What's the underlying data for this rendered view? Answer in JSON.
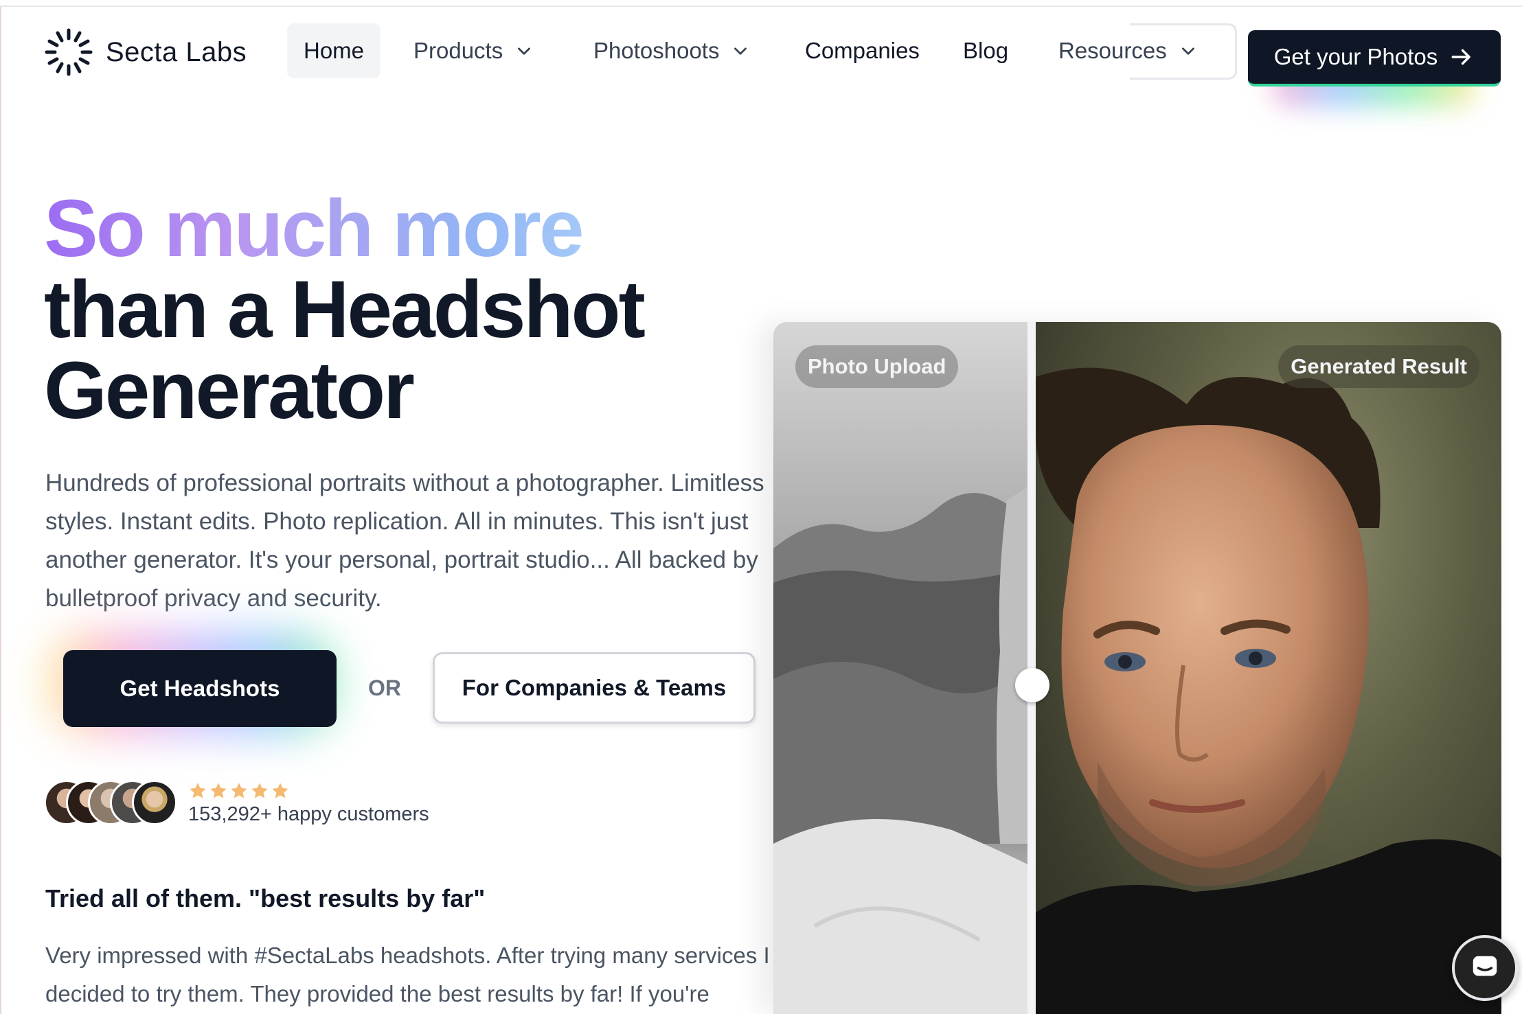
{
  "brand": {
    "name": "Secta Labs",
    "logo_icon": "sun-burst-logo"
  },
  "nav": {
    "home": "Home",
    "products": "Products",
    "photoshoots": "Photoshoots",
    "companies": "Companies",
    "blog": "Blog",
    "resources": "Resources",
    "cta": "Get your Photos"
  },
  "hero": {
    "line1": "So much more",
    "line2": "than a Headshot",
    "line3": "Generator",
    "description": "Hundreds of professional portraits without a photographer. Limitless styles. Instant edits. Photo replication. All in minutes. This isn't just another generator. It's your personal, portrait studio... All backed by bulletproof privacy and security.",
    "primary_button": "Get Headshots",
    "or_label": "OR",
    "secondary_button": "For Companies & Teams",
    "rating_stars": 5,
    "customers": "153,292+ happy customers"
  },
  "testimonial": {
    "title": "Tried all of them. \"best results by far\"",
    "body": "Very impressed with #SectaLabs headshots. After trying many services I decided to try them. They provided the best results by far! If you're"
  },
  "compare": {
    "left_label": "Photo Upload",
    "right_label": "Generated Result"
  },
  "colors": {
    "dark": "#0f1726",
    "heading_gradient_start": "#9b6cf2",
    "heading_gradient_end": "#a5c8f8",
    "star": "#f5b971"
  }
}
